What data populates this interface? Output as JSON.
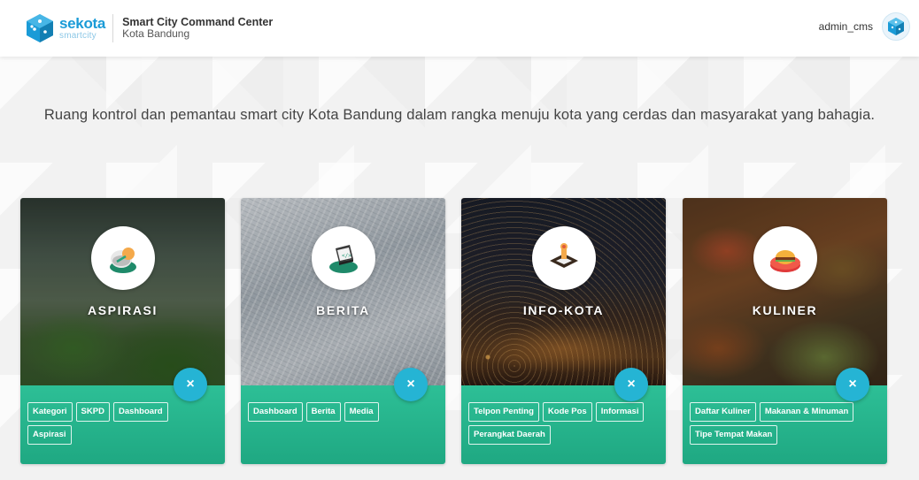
{
  "header": {
    "brand": "sekota",
    "brand_sub": "smartcity",
    "title": "Smart City Command Center",
    "subtitle": "Kota Bandung",
    "username": "admin_cms"
  },
  "tagline": "Ruang kontrol dan pemantau smart city Kota Bandung dalam rangka menuju kota yang cerdas dan masyarakat yang bahagia.",
  "colors": {
    "brand_blue": "#1a9bd7",
    "card_green": "#2dbf96",
    "close_button": "#25b4d4"
  },
  "cards": [
    {
      "title": "ASPIRASI",
      "icon": "aspirasi-icon",
      "close_symbol": "×",
      "tags": [
        "Kategori",
        "SKPD",
        "Dashboard",
        "Aspirasi"
      ]
    },
    {
      "title": "BERITA",
      "icon": "berita-icon",
      "close_symbol": "×",
      "tags": [
        "Dashboard",
        "Berita",
        "Media"
      ]
    },
    {
      "title": "INFO-KOTA",
      "icon": "info-kota-icon",
      "close_symbol": "×",
      "tags": [
        "Telpon Penting",
        "Kode Pos",
        "Informasi",
        "Perangkat Daerah"
      ]
    },
    {
      "title": "KULINER",
      "icon": "kuliner-icon",
      "close_symbol": "×",
      "tags": [
        "Daftar Kuliner",
        "Makanan & Minuman",
        "Tipe Tempat Makan"
      ]
    }
  ]
}
